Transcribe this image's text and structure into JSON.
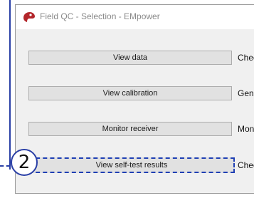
{
  "window": {
    "title": "Field QC - Selection - EMpower",
    "icon": "empower-logo-icon"
  },
  "rows": [
    {
      "button_label": "View data",
      "description": "Chec"
    },
    {
      "button_label": "View calibration",
      "description": "Gene"
    },
    {
      "button_label": "Monitor receiver",
      "description": "Mon"
    },
    {
      "button_label": "View self-test results",
      "description": "Chec"
    }
  ],
  "callout": {
    "number": "2",
    "color": "#2a3fa6"
  },
  "colors": {
    "focus_outline": "#1f3fb4",
    "button_face": "#e1e1e1"
  }
}
